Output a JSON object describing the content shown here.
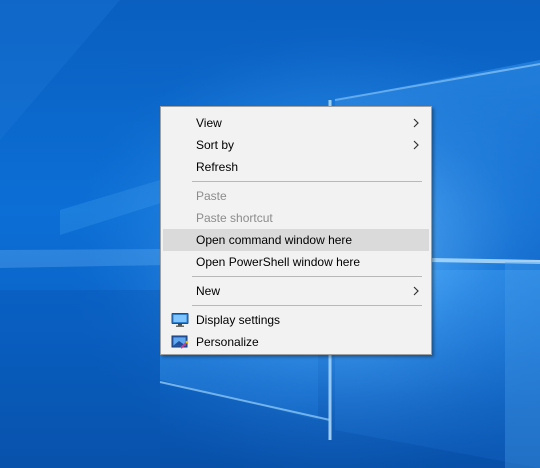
{
  "context_menu": {
    "items": [
      {
        "label": "View",
        "has_submenu": true,
        "enabled": true
      },
      {
        "label": "Sort by",
        "has_submenu": true,
        "enabled": true
      },
      {
        "label": "Refresh",
        "has_submenu": false,
        "enabled": true
      },
      {
        "label": "Paste",
        "has_submenu": false,
        "enabled": false
      },
      {
        "label": "Paste shortcut",
        "has_submenu": false,
        "enabled": false
      },
      {
        "label": "Open command window here",
        "has_submenu": false,
        "enabled": true,
        "highlighted": true
      },
      {
        "label": "Open PowerShell window here",
        "has_submenu": false,
        "enabled": true
      },
      {
        "label": "New",
        "has_submenu": true,
        "enabled": true
      },
      {
        "label": "Display settings",
        "icon": "display-settings-icon",
        "enabled": true
      },
      {
        "label": "Personalize",
        "icon": "personalize-icon",
        "enabled": true
      }
    ]
  },
  "colors": {
    "menu_background": "#f2f2f2",
    "highlight": "#dadada",
    "disabled_text": "#8c8c8c",
    "desktop_blue": "#0b63c6"
  }
}
